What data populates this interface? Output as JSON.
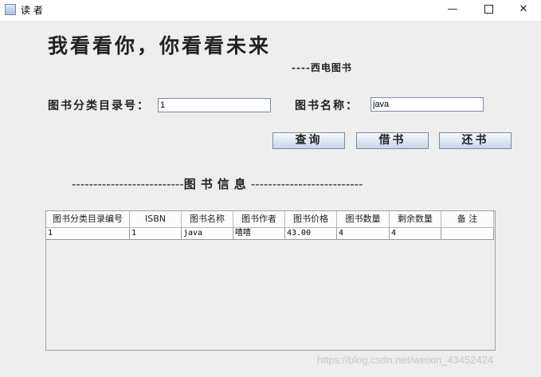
{
  "window": {
    "title": "读 者",
    "minimize": "—",
    "close": "✕"
  },
  "header": {
    "headline": "我看看你，你看看未来",
    "sub_headline": "----西电图书"
  },
  "search": {
    "category_label": "图书分类目录号：",
    "category_value": "1",
    "name_label": "图书名称：",
    "name_value": "java"
  },
  "buttons": {
    "query": "查询",
    "borrow": "借书",
    "return": "还书"
  },
  "section": {
    "dashes_left": "--------------------------",
    "title": "图书信息",
    "dashes_right": "--------------------------"
  },
  "table": {
    "columns": [
      "图书分类目录编号",
      "ISBN",
      "图书名称",
      "图书作者",
      "图书价格",
      "图书数量",
      "剩余数量",
      "备 注"
    ],
    "rows": [
      [
        "1",
        "1",
        "java",
        "嘻嘻",
        "43.00",
        "4",
        "4",
        ""
      ]
    ]
  },
  "watermark": "https://blog.csdn.net/weixin_43452424"
}
